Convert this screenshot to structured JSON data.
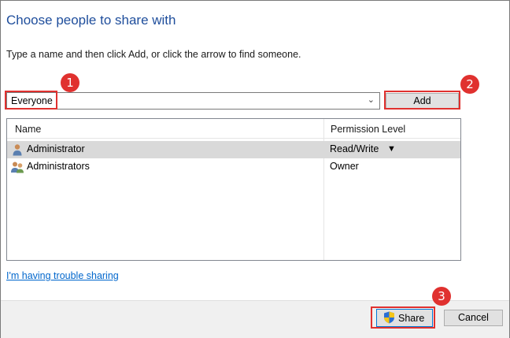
{
  "dialog": {
    "title": "Choose people to share with",
    "instruction": "Type a name and then click Add, or click the arrow to find someone."
  },
  "name_input": {
    "value": "Everyone",
    "dropdown_icon": "chevron-down-icon"
  },
  "add_button": {
    "label": "Add"
  },
  "list": {
    "columns": [
      "Name",
      "Permission Level"
    ],
    "rows": [
      {
        "name": "Administrator",
        "permission": "Read/Write",
        "icon": "user-icon",
        "selected": true
      },
      {
        "name": "Administrators",
        "permission": "Owner",
        "icon": "users-group-icon",
        "selected": false
      }
    ]
  },
  "trouble_link": "I'm having trouble sharing",
  "footer": {
    "share_label": "Share",
    "cancel_label": "Cancel"
  },
  "annotations": [
    "1",
    "2",
    "3"
  ],
  "colors": {
    "title": "#1f4e9c",
    "link": "#0066cc",
    "highlight": "#e0312f",
    "selected_row": "#d9d9d9"
  }
}
